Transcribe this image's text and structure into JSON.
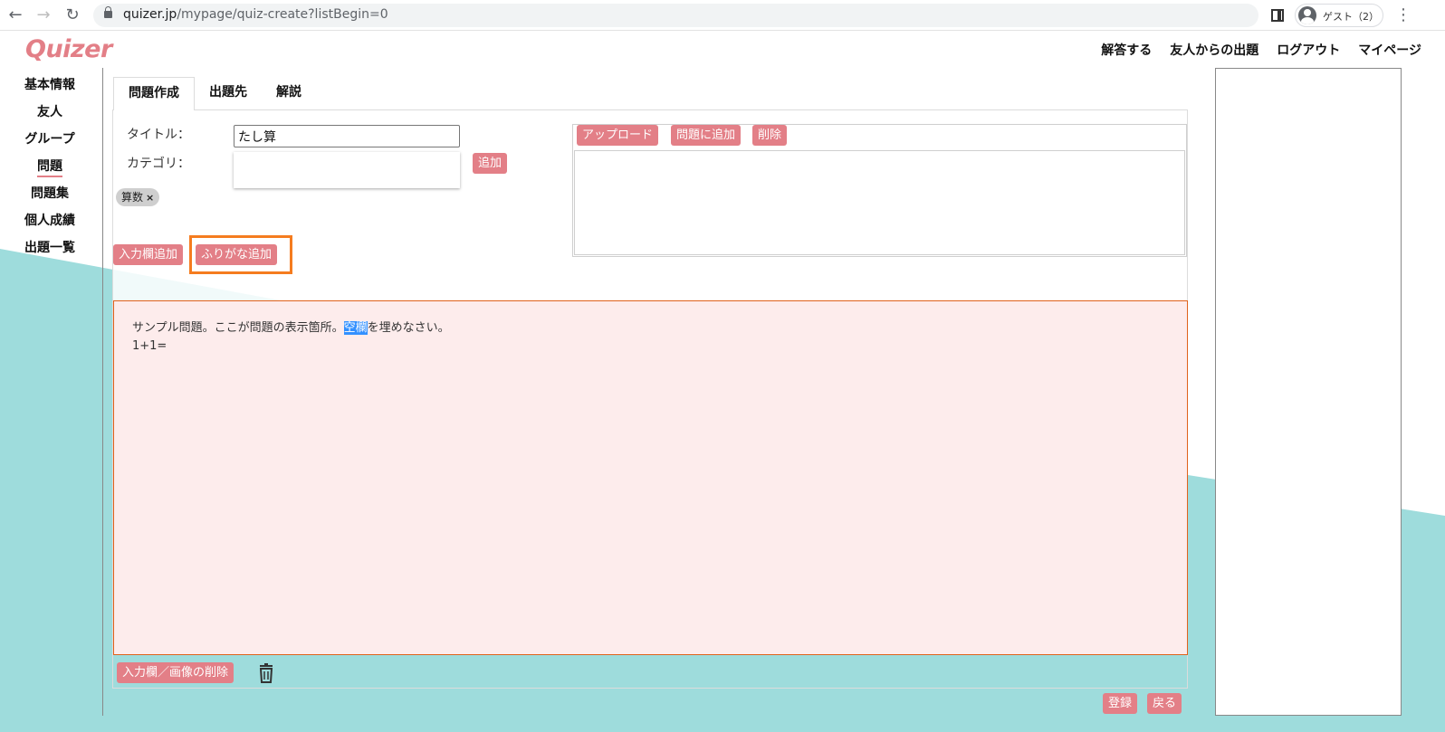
{
  "browser": {
    "url_host": "quizer.jp",
    "url_path": "/mypage/quiz-create?listBegin=0",
    "profile_label": "ゲスト（2）"
  },
  "header": {
    "logo": "Quizer",
    "nav": [
      "解答する",
      "友人からの出題",
      "ログアウト",
      "マイページ"
    ]
  },
  "sidebar": {
    "items": [
      {
        "label": "基本情報",
        "active": false
      },
      {
        "label": "友人",
        "active": false
      },
      {
        "label": "グループ",
        "active": false
      },
      {
        "label": "問題",
        "active": true
      },
      {
        "label": "問題集",
        "active": false
      },
      {
        "label": "個人成績",
        "active": false
      },
      {
        "label": "出題一覧",
        "active": false
      }
    ]
  },
  "tabs": [
    "問題作成",
    "出題先",
    "解説"
  ],
  "form": {
    "title_label": "タイトル：",
    "title_value": "たし算",
    "category_label": "カテゴリ：",
    "add_button": "追加",
    "category_chip": "算数",
    "chip_remove": "×",
    "add_input_button": "入力欄追加",
    "add_furigana_button": "ふりがな追加"
  },
  "image_panel": {
    "upload_button": "アップロード",
    "add_to_question_button": "問題に追加",
    "delete_button": "削除"
  },
  "editor": {
    "line1_before": "サンプル問題。ここが問題の表示箇所。",
    "line1_selected": "空欄",
    "line1_after": "を埋めなさい。",
    "line2": "1+1="
  },
  "footer": {
    "delete_input_image_button": "入力欄／画像の削除",
    "register_button": "登録",
    "back_button": "戻る"
  },
  "colors": {
    "accent": "#e37f87",
    "teal": "#9edcdc",
    "editor_bg": "#fdecec",
    "highlight": "#f57c1f"
  }
}
